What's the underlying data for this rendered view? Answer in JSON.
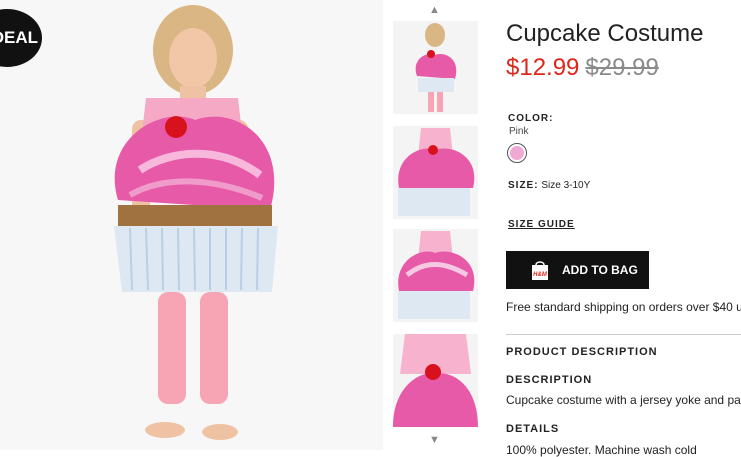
{
  "badge": "DEAL",
  "product": {
    "title": "Cupcake Costume",
    "price_sale": "$12.99",
    "price_original": "$29.99"
  },
  "color": {
    "label": "COLOR:",
    "value": "Pink",
    "swatch_color": "#f2a8d4"
  },
  "size": {
    "label": "SIZE:",
    "value": "Size  3-10Y"
  },
  "size_guide": "SIZE GUIDE",
  "add_to_bag": {
    "label": "ADD TO BAG",
    "icon_text": "H&M"
  },
  "shipping": "Free standard shipping on orders over $40 u",
  "product_description": {
    "heading": "PRODUCT DESCRIPTION",
    "description_label": "DESCRIPTION",
    "description_text": "Cupcake costume with a jersey yoke and pad",
    "details_label": "DETAILS",
    "details_text": "100% polyester. Machine wash cold"
  },
  "thumbnails": [
    "full-figure",
    "costume-front",
    "costume-back",
    "costume-closeup"
  ],
  "colors": {
    "sale": "#e0261b",
    "button": "#111111",
    "costume_pink": "#e65aa8",
    "liner": "#dde8f2"
  }
}
